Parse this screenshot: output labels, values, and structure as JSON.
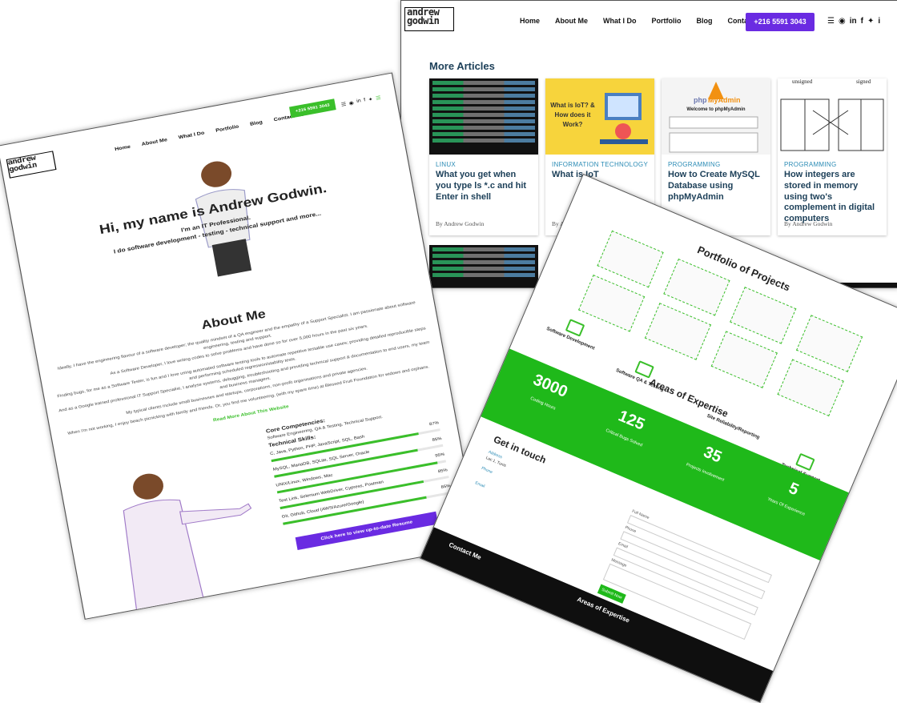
{
  "blog": {
    "logo": [
      "andrew",
      "godwin"
    ],
    "nav": [
      "Home",
      "About Me",
      "What I Do",
      "Portfolio",
      "Blog",
      "Contact Me"
    ],
    "phone": "+216 5591 3043",
    "section_title": "More Articles",
    "cards": [
      {
        "category": "LINUX",
        "title": "What you get when you type ls *.c and hit Enter in shell",
        "author": "By Andrew Godwin"
      },
      {
        "category": "INFORMATION TECHNOLOGY",
        "title": "What is IoT",
        "author": "By A",
        "thumb_text": "What is IoT? & How does it Work?"
      },
      {
        "category": "PROGRAMMING",
        "title": "How to Create MySQL Database using phpMyAdmin",
        "author": "",
        "thumb_text": "Welcome to phpMyAdmin"
      },
      {
        "category": "PROGRAMMING",
        "title": "How integers are stored in memory using two's complement in digital computers",
        "author": "By Andrew Godwin",
        "thumb_left": "unsigned",
        "thumb_right": "signed"
      }
    ]
  },
  "home": {
    "logo": [
      "andrew",
      "godwin"
    ],
    "nav": [
      "Home",
      "About Me",
      "What I Do",
      "Portfolio",
      "Blog",
      "Contact Me"
    ],
    "phone": "+216 5591 3043",
    "greeting": "Hi, my name is Andrew Godwin.",
    "tagline1": "I'm an IT Professional.",
    "tagline2": "I do software development - testing - technical support and more...",
    "about_title": "About Me",
    "paragraphs": [
      "Ideally, I have the engineering flavour of a software developer; the quality mindset of a QA engineer and the empathy of a Support Specialist. I am passionate about software engineering, testing and support.",
      "As a Software Developer, I love writing codes to solve problems and have done so for over 5,000 hours in the past six years.",
      "Finding bugs, for me as a Software Tester, is fun and I love using automated software testing tools to automate repetitive testable use cases; providing detailed reproducible steps and performing scheduled regression/stability tests.",
      "And as a Google trained professional IT Support Specialist, I analyse systems, debugging, troubleshooting and providing technical support & documentation to end users, my team and business managers.",
      "My typical clients include small businesses and startups, corporations, non-profit organisations and private agencies.",
      "When I'm not working, I enjoy beach picnicking with family and friends. Or, you find me volunteering, (with my spare time) at Blessed Fruit Foundation for widows and orphans."
    ],
    "read_more": "Read More About This Website",
    "core_title": "Core Competencies:",
    "core_text": "Software Engineering, QA & Testing, Technical Support.",
    "skills_title": "Technical Skills:",
    "skills": [
      {
        "label": "C, Java, Python, PHP, JavaScript, SQL, Bash",
        "percent": 87
      },
      {
        "label": "MySQL, MariaDB, SQLite, SQL Server, Oracle",
        "percent": 85
      },
      {
        "label": "UNIX/Linux, Windows, Mac",
        "percent": 95
      },
      {
        "label": "Test Link, Selenium WebDriver, Cypress, Postman",
        "percent": 85
      },
      {
        "label": "Git, Github, Cloud (AWS/Azure/Google)",
        "percent": 85
      }
    ],
    "resume_button": "Click here to view up-to-date Resume"
  },
  "portfolio": {
    "title": "Portfolio of Projects",
    "areas_title": "Areas of Expertise",
    "services": [
      "Software Development",
      "Software QA & Testing",
      "Site Reliability/Reporting",
      "Technical Support"
    ],
    "stats": [
      {
        "value": "3000",
        "label": "Coding Hours"
      },
      {
        "value": "125",
        "label": "Critical Bugs Solved"
      },
      {
        "value": "35",
        "label": "Projects Involvement"
      },
      {
        "value": "5",
        "label": "Years Of Experience"
      }
    ],
    "get_in_touch": "Get in touch",
    "address_label": "Address",
    "address": "Lac 1, Tunis",
    "phone_label": "Phone",
    "email_label": "Email",
    "form_labels": [
      "Full Name",
      "Phone",
      "Email",
      "Message"
    ],
    "send": "Submit Now",
    "footer_contact": "Contact Me",
    "footer_areas": "Areas of Expertise"
  },
  "colors": {
    "accent": "#6a2be2",
    "green": "#1fb91a",
    "title_blue": "#1d4059"
  }
}
